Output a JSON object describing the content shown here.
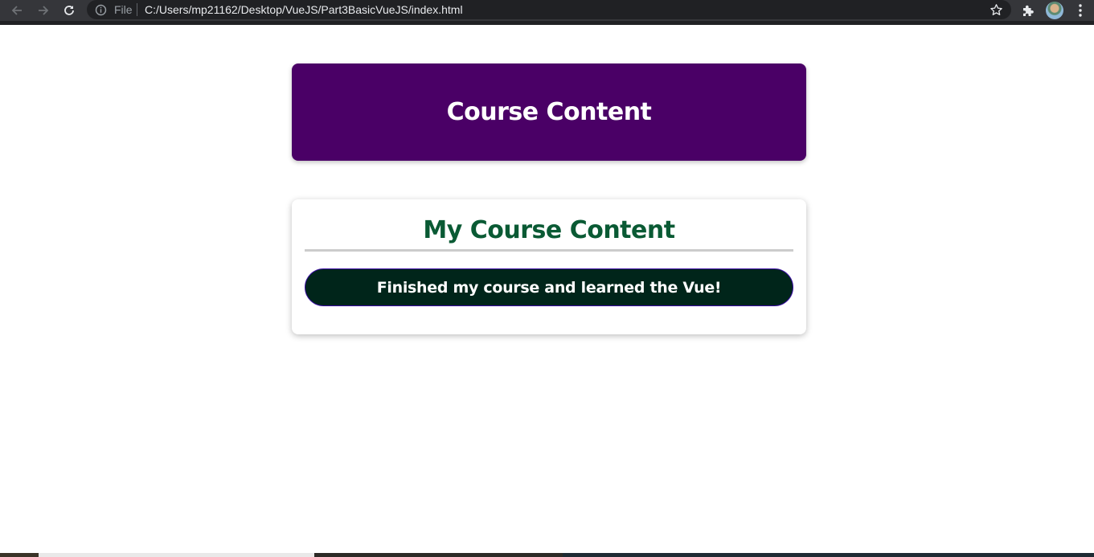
{
  "browser": {
    "file_label": "File",
    "url": "C:/Users/mp21162/Desktop/VueJS/Part3BasicVueJS/index.html",
    "icons": {
      "back": "arrow-left-icon",
      "forward": "arrow-right-icon",
      "reload": "reload-icon",
      "info": "info-icon",
      "bookmark": "star-icon",
      "extensions": "puzzle-icon",
      "profile": "avatar",
      "menu": "kebab-menu-icon"
    }
  },
  "header": {
    "title": "Course Content",
    "background_color": "#4a0066"
  },
  "content": {
    "title": "My Course Content",
    "title_color": "#0a5a34",
    "goal_text": "Finished my course and learned the Vue!",
    "goal_background": "#00251a",
    "goal_border": "#3a0ca3"
  }
}
